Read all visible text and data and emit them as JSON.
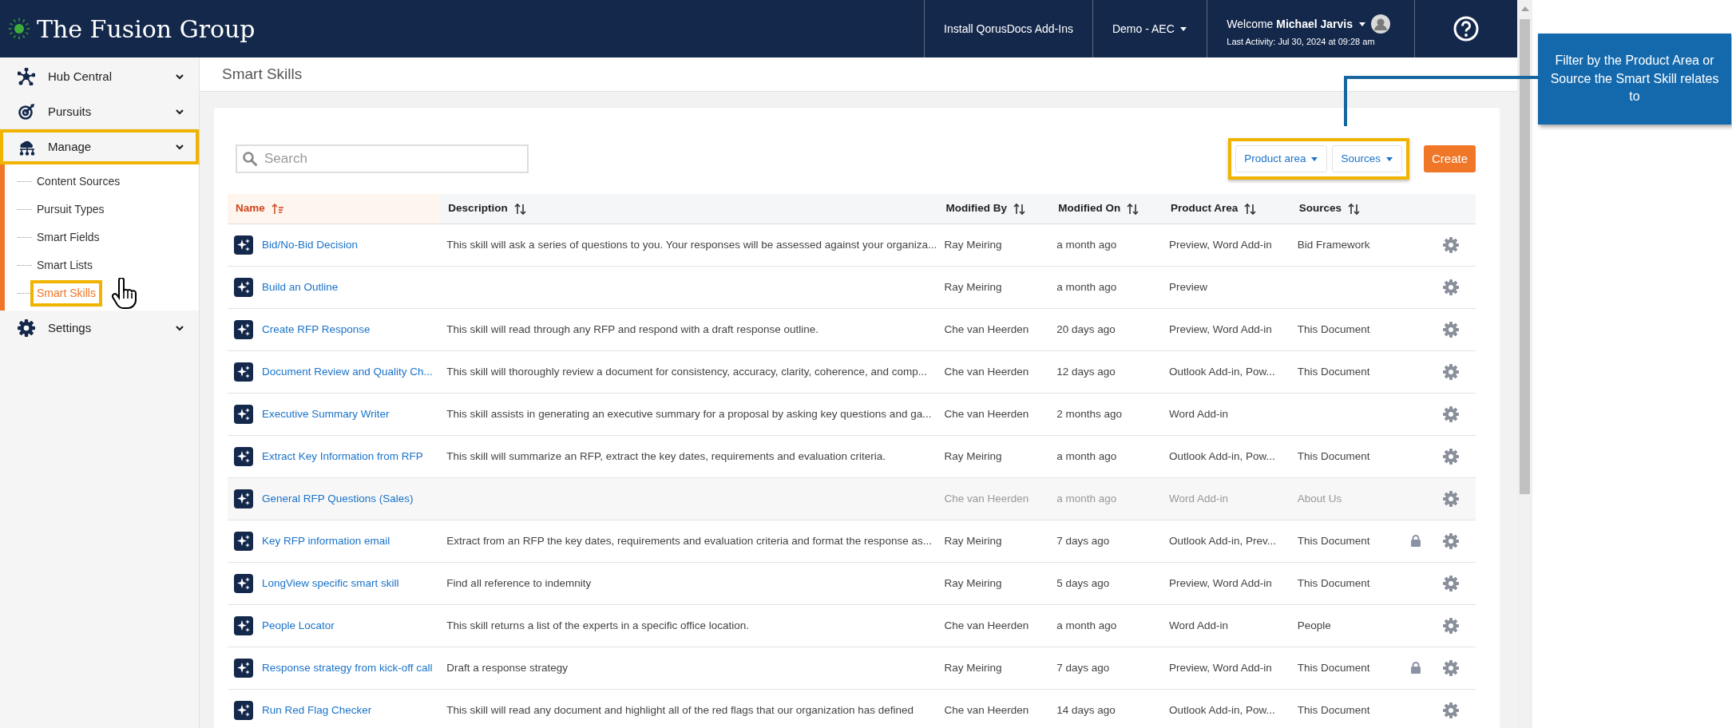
{
  "header": {
    "logo": "The Fusion Group",
    "links": [
      {
        "label": "Install QorusDocs Add-Ins",
        "kind": "link"
      },
      {
        "label": "Demo - AEC",
        "kind": "dropdown"
      }
    ],
    "user": {
      "welcome": "Welcome **Michael Jarvis**",
      "last_activity": "Last Activity: Jul 30, 2024 at 09:28 am"
    }
  },
  "sidebar": {
    "items": [
      {
        "label": "Hub Central",
        "highlighted": false
      },
      {
        "label": "Pursuits",
        "highlighted": false
      },
      {
        "label": "Manage",
        "expanded": true,
        "highlighted": true,
        "children": [
          {
            "label": "Content Sources",
            "selected": false,
            "highlighted": false
          },
          {
            "label": "Pursuit Types",
            "selected": false,
            "highlighted": false
          },
          {
            "label": "Smart Fields",
            "selected": false,
            "highlighted": false
          },
          {
            "label": "Smart Lists",
            "selected": false,
            "highlighted": false
          },
          {
            "label": "Smart Skills",
            "selected": true,
            "highlighted": true
          }
        ]
      },
      {
        "label": "Settings",
        "highlighted": false
      }
    ]
  },
  "page_title": "Smart Skills",
  "search": {
    "placeholder": "Search"
  },
  "filters": {
    "highlighted": true,
    "items": [
      {
        "label": "Product area"
      },
      {
        "label": "Sources"
      }
    ]
  },
  "create_button": "Create",
  "table": {
    "columns": [
      {
        "label": "Name",
        "sorted": true
      },
      {
        "label": "Description",
        "sorted": false
      },
      {
        "label": "Modified By",
        "sorted": false
      },
      {
        "label": "Modified On",
        "sorted": false
      },
      {
        "label": "Product Area",
        "sorted": false
      },
      {
        "label": "Sources",
        "sorted": false
      }
    ],
    "rows": [
      {
        "name": "Bid/No-Bid Decision",
        "description": "This skill will ask a series of questions to you. Your responses will be assessed against your organiza...",
        "modified_by": "Ray Meiring",
        "modified_on": "a month ago",
        "product_area": "Preview, Word Add-in",
        "sources": "Bid Framework",
        "locked": false,
        "inactive": false
      },
      {
        "name": "Build an Outline",
        "modified_by": "Ray Meiring",
        "modified_on": "a month ago",
        "product_area": "Preview",
        "locked": false,
        "inactive": false
      },
      {
        "name": "Create RFP Response",
        "description": "This skill will read through any RFP and respond with a draft response outline.",
        "modified_by": "Che van Heerden",
        "modified_on": "20 days ago",
        "product_area": "Preview, Word Add-in",
        "sources": "This Document",
        "locked": false,
        "inactive": false
      },
      {
        "name": "Document Review and Quality Ch...",
        "description": "This skill will thoroughly review a document for consistency, accuracy, clarity, coherence, and comp...",
        "modified_by": "Che van Heerden",
        "modified_on": "12 days ago",
        "product_area": "Outlook Add-in, Pow...",
        "sources": "This Document",
        "locked": false,
        "inactive": false
      },
      {
        "name": "Executive Summary Writer",
        "description": "This skill assists in generating an executive summary for a proposal by asking key questions and ga...",
        "modified_by": "Che van Heerden",
        "modified_on": "2 months ago",
        "product_area": "Word Add-in",
        "locked": false,
        "inactive": false
      },
      {
        "name": "Extract Key Information from RFP",
        "description": "This skill will summarize an RFP, extract the key dates, requirements and evaluation criteria.",
        "modified_by": "Ray Meiring",
        "modified_on": "a month ago",
        "product_area": "Outlook Add-in, Pow...",
        "sources": "This Document",
        "locked": false,
        "inactive": false
      },
      {
        "name": "General RFP Questions (Sales)",
        "modified_by": "Che van Heerden",
        "modified_on": "a month ago",
        "product_area": "Word Add-in",
        "sources": "About Us",
        "locked": false,
        "inactive": true
      },
      {
        "name": "Key RFP information email",
        "description": "Extract from an RFP the key dates, requirements and evaluation criteria and format the response as...",
        "modified_by": "Ray Meiring",
        "modified_on": "7 days ago",
        "product_area": "Outlook Add-in, Prev...",
        "sources": "This Document",
        "locked": true,
        "inactive": false
      },
      {
        "name": "LongView specific smart skill",
        "description": "Find all reference to indemnity",
        "modified_by": "Ray Meiring",
        "modified_on": "5 days ago",
        "product_area": "Preview, Word Add-in",
        "sources": "This Document",
        "locked": false,
        "inactive": false
      },
      {
        "name": "People Locator",
        "description": "This skill returns a list of the experts in a specific office location.",
        "modified_by": "Che van Heerden",
        "modified_on": "a month ago",
        "product_area": "Word Add-in",
        "sources": "People",
        "locked": false,
        "inactive": false
      },
      {
        "name": "Response strategy from kick-off call",
        "description": "Draft a response strategy",
        "modified_by": "Ray Meiring",
        "modified_on": "7 days ago",
        "product_area": "Preview, Word Add-in",
        "sources": "This Document",
        "locked": true,
        "inactive": false
      },
      {
        "name": "Run Red Flag Checker",
        "description": "This skill will read any document and highlight all of the red flags that our organization has defined",
        "modified_by": "Che van Heerden",
        "modified_on": "14 days ago",
        "product_area": "Outlook Add-in, Pow...",
        "sources": "This Document",
        "locked": false,
        "inactive": false
      }
    ]
  },
  "callout": {
    "text": "Filter by the Product Area or Source the Smart Skill relates to"
  }
}
